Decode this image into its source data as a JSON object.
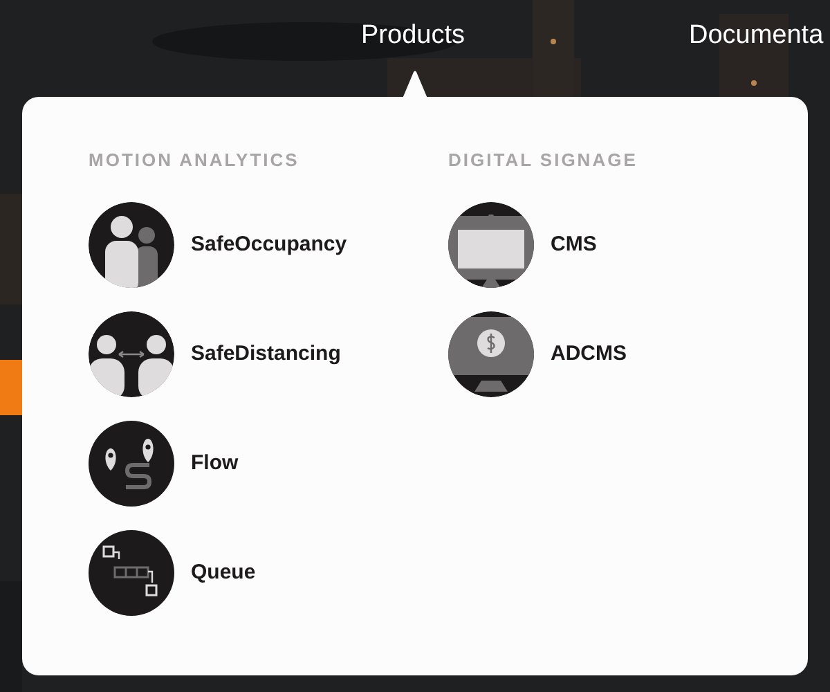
{
  "nav": [
    {
      "label": "Products"
    },
    {
      "label": "Documenta"
    }
  ],
  "menu": {
    "columns": [
      {
        "heading": "MOTION ANALYTICS",
        "items": [
          {
            "label": "SafeOccupancy",
            "kind": "occupancy"
          },
          {
            "label": "SafeDistancing",
            "kind": "distancing"
          },
          {
            "label": "Flow",
            "kind": "flow"
          },
          {
            "label": "Queue",
            "kind": "queue"
          }
        ]
      },
      {
        "heading": "DIGITAL SIGNAGE",
        "items": [
          {
            "label": "CMS",
            "kind": "screen"
          },
          {
            "label": "ADCMS",
            "kind": "ad"
          }
        ]
      }
    ]
  }
}
